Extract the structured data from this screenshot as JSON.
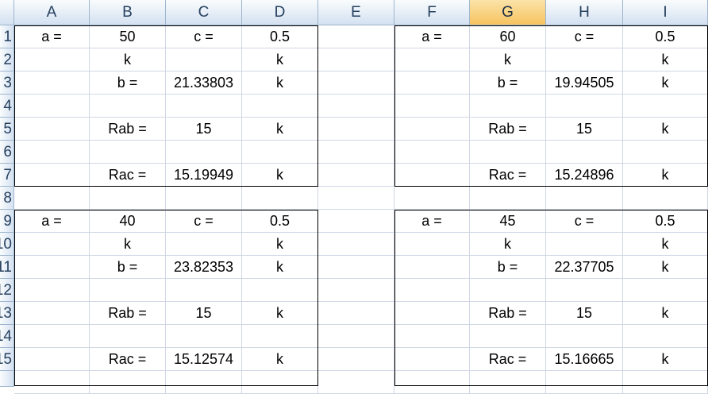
{
  "columns": [
    "A",
    "B",
    "C",
    "D",
    "E",
    "F",
    "G",
    "H",
    "I"
  ],
  "selected_column": "G",
  "rows": [
    "1",
    "2",
    "3",
    "4",
    "5",
    "6",
    "7",
    "8",
    "9",
    "10",
    "11",
    "12",
    "13",
    "14",
    "15"
  ],
  "cells": {
    "A1": "a =",
    "B1": "50",
    "C1": "c =",
    "D1": "0.5",
    "B2": "k",
    "D2": "k",
    "B3": "b =",
    "C3": "21.33803",
    "D3": "k",
    "B5": "Rab =",
    "C5": "15",
    "D5": "k",
    "B7": "Rac =",
    "C7": "15.19949",
    "D7": "k",
    "F1": "a =",
    "G1": "60",
    "H1": "c =",
    "I1": "0.5",
    "G2": "k",
    "I2": "k",
    "G3": "b =",
    "H3": "19.94505",
    "I3": "k",
    "G5": "Rab =",
    "H5": "15",
    "I5": "k",
    "G7": "Rac =",
    "H7": "15.24896",
    "I7": "k",
    "A9": "a =",
    "B9": "40",
    "C9": "c =",
    "D9": "0.5",
    "B10": "k",
    "D10": "k",
    "B11": "b =",
    "C11": "23.82353",
    "D11": "k",
    "B13": "Rab =",
    "C13": "15",
    "D13": "k",
    "B15": "Rac =",
    "C15": "15.12574",
    "D15": "k",
    "F9": "a =",
    "G9": "45",
    "H9": "c =",
    "I9": "0.5",
    "G10": "k",
    "I10": "k",
    "G11": "b =",
    "H11": "22.37705",
    "I11": "k",
    "G13": "Rab =",
    "H13": "15",
    "I13": "k",
    "G15": "Rac =",
    "H15": "15.16665",
    "I15": "k"
  }
}
